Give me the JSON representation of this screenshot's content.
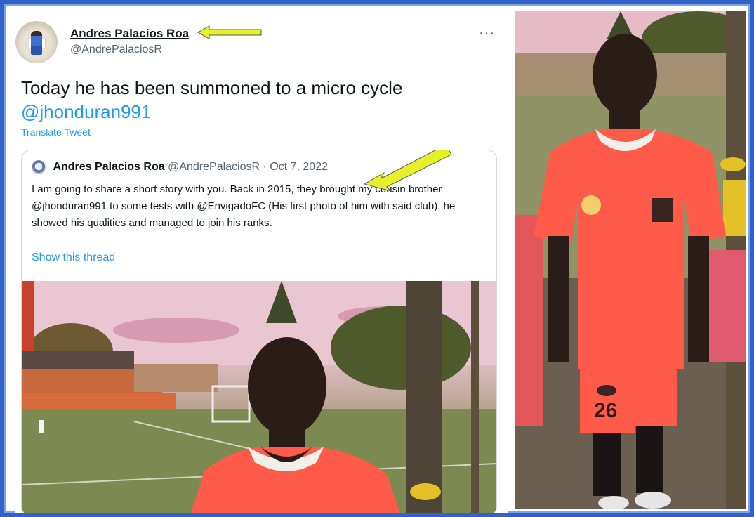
{
  "tweet": {
    "author_name": "Andres Palacios Roa",
    "author_handle": "@AndrePalaciosR",
    "more_label": "···",
    "text": "Today he has been summoned to a micro cycle",
    "mention": "@jhonduran991",
    "translate_label": "Translate Tweet"
  },
  "quoted": {
    "author_name": "Andres Palacios Roa",
    "author_handle": "@AndrePalaciosR",
    "separator": "·",
    "date": "Oct 7, 2022",
    "body": "I am going to share a short story with you. Back in 2015, they brought my cousin brother @jhonduran991 to some tests with @EnvigadoFC (His first photo of him with said club), he showed his qualities and managed to join his ranks.",
    "show_thread_label": "Show this thread"
  },
  "jersey_number": "26",
  "colors": {
    "arrow": "#e5ef2a",
    "link": "#1d9bf0",
    "border": "#2f63c6",
    "jersey": "#ff5a4a"
  }
}
